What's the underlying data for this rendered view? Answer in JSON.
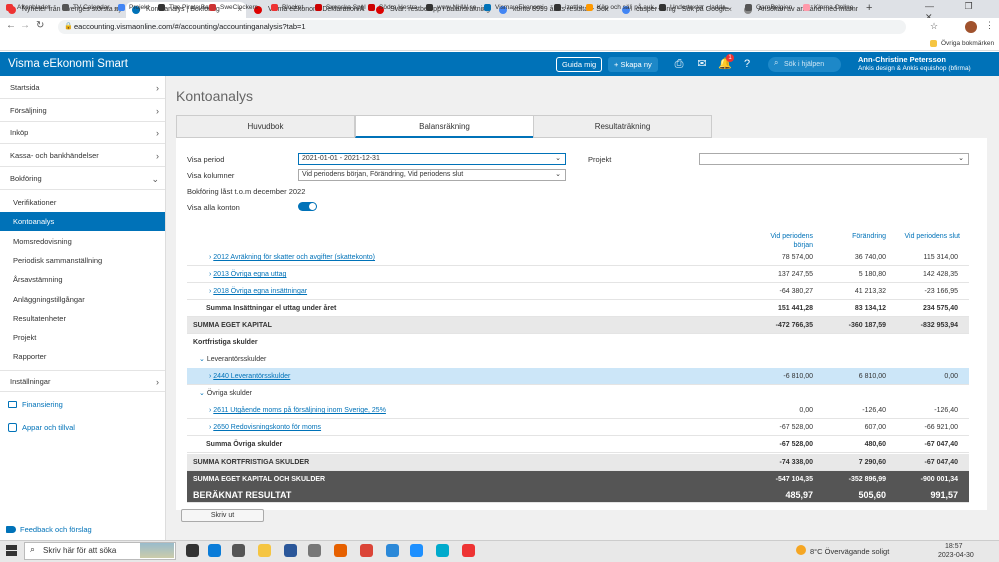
{
  "browser": {
    "tabs": [
      {
        "title": "Nyheter från Sveriges största ny",
        "color": "#e33"
      },
      {
        "title": "Kontoanalys | Bokföring",
        "color": "#0072b8"
      },
      {
        "title": "Visma eEkonomi Deklaration/Å",
        "color": "#d00"
      },
      {
        "title": "Svar: restbelopp i balansräkning",
        "color": "#d00"
      },
      {
        "title": "konto 8999 årets resultat - Sök",
        "color": "#4285f4"
      },
      {
        "title": "casper konig - Sök på Google",
        "color": "#4285f4"
      },
      {
        "title": "Ansökan av anstånd med inlämn",
        "color": "#888"
      }
    ],
    "url": "eaccounting.vismaonline.com/#/accounting/accountinganalysis?tab=1",
    "bookmarks": [
      {
        "label": "Aftonbladet",
        "color": "#e33"
      },
      {
        "label": "TV Calendar",
        "color": "#555"
      },
      {
        "label": "Projekt",
        "color": "#4285f4"
      },
      {
        "label": "The Pirate Bay",
        "color": "#333"
      },
      {
        "label": "SweClockers",
        "color": "#c33"
      },
      {
        "label": "Blocket",
        "color": "#e33"
      },
      {
        "label": "Svenska Spel",
        "color": "#c00"
      },
      {
        "label": "Södra Hestra",
        "color": "#c00"
      },
      {
        "label": "www.NHW.se",
        "color": "#333"
      },
      {
        "label": "Visma eEkonomi",
        "color": "#0072b8"
      },
      {
        "label": "izettle",
        "color": "#333"
      },
      {
        "label": "Köp och sälj på auk...",
        "color": "#f90"
      },
      {
        "label": "Undertexter - ladda...",
        "color": "#333"
      },
      {
        "label": "GarnBelgien",
        "color": "#555"
      },
      {
        "label": "Klarna Online",
        "color": "#f9a"
      }
    ],
    "other_bookmarks": "Övriga bokmärken"
  },
  "header": {
    "brand": "Visma eEkonomi Smart",
    "guide": "Guida mig",
    "create": "+ Skapa ny",
    "search_placeholder": "Sök i hjälpen",
    "notification_count": "1",
    "user_name": "Ann-Christine Petersson",
    "company": "Ankis design & Ankis equishop (bfirma)"
  },
  "sidebar": {
    "items": [
      "Startsida",
      "Försäljning",
      "Inköp",
      "Kassa- och bankhändelser",
      "Bokföring"
    ],
    "sub": [
      "Verifikationer",
      "Kontoanalys",
      "Momsredovisning",
      "Periodisk sammanställning",
      "Årsavstämning",
      "Anläggningstillgångar",
      "Resultatenheter",
      "Projekt",
      "Rapporter"
    ],
    "settings": "Inställningar",
    "financing": "Finansiering",
    "apps": "Appar och tillval",
    "feedback": "Feedback och förslag"
  },
  "page": {
    "title": "Kontoanalys",
    "tabs": [
      "Huvudbok",
      "Balansräkning",
      "Resultaträkning"
    ],
    "period_label": "Visa period",
    "period_value": "2021-01-01 - 2021-12-31",
    "columns_label": "Visa kolumner",
    "columns_value": "Vid periodens början, Förändring, Vid periodens slut",
    "project_label": "Projekt",
    "locked_text": "Bokföring låst t.o.m december 2022",
    "show_all": "Visa alla konton",
    "col_start": "Vid periodens början",
    "col_change": "Förändring",
    "col_end": "Vid periodens slut",
    "print": "Skriv ut"
  },
  "rows": [
    {
      "name": "2012 Avräkning för skatter och avgifter (skattekonto)",
      "start": "78 574,00",
      "change": "36 740,00",
      "end": "115 314,00",
      "type": "link",
      "indent": 1
    },
    {
      "name": "2013 Övriga egna uttag",
      "start": "137 247,55",
      "change": "5 180,80",
      "end": "142 428,35",
      "type": "link",
      "indent": 1
    },
    {
      "name": "2018 Övriga egna insättningar",
      "start": "-64 380,27",
      "change": "41 213,32",
      "end": "-23 166,95",
      "type": "link",
      "indent": 1
    },
    {
      "name": "Summa Insättningar el uttag under året",
      "start": "151 441,28",
      "change": "83 134,12",
      "end": "234 575,40",
      "type": "sum",
      "indent": 0
    },
    {
      "name": "SUMMA EGET KAPITAL",
      "start": "-472 766,35",
      "change": "-360 187,59",
      "end": "-832 953,94",
      "type": "gray",
      "indent": 0
    },
    {
      "name": "Kortfristiga skulder",
      "start": "",
      "change": "",
      "end": "",
      "type": "heading",
      "indent": 0
    },
    {
      "name": "Leverantörsskulder",
      "start": "",
      "change": "",
      "end": "",
      "type": "group",
      "indent": 0
    },
    {
      "name": "2440 Leverantörsskulder",
      "start": "-6 810,00",
      "change": "6 810,00",
      "end": "0,00",
      "type": "link-hl",
      "indent": 1
    },
    {
      "name": "Övriga skulder",
      "start": "",
      "change": "",
      "end": "",
      "type": "group",
      "indent": 0
    },
    {
      "name": "2611 Utgående moms på försäljning inom Sverige, 25%",
      "start": "0,00",
      "change": "-126,40",
      "end": "-126,40",
      "type": "link",
      "indent": 1
    },
    {
      "name": "2650 Redovisningskonto för moms",
      "start": "-67 528,00",
      "change": "607,00",
      "end": "-66 921,00",
      "type": "link",
      "indent": 1
    },
    {
      "name": "Summa Övriga skulder",
      "start": "-67 528,00",
      "change": "480,60",
      "end": "-67 047,40",
      "type": "sum",
      "indent": 0
    },
    {
      "name": "SUMMA KORTFRISTIGA SKULDER",
      "start": "-74 338,00",
      "change": "7 290,60",
      "end": "-67 047,40",
      "type": "gray",
      "indent": 0
    },
    {
      "name": "SUMMA EGET KAPITAL OCH SKULDER",
      "start": "-547 104,35",
      "change": "-352 896,99",
      "end": "-900 001,34",
      "type": "dark",
      "indent": 0
    },
    {
      "name": "BERÄKNAT RESULTAT",
      "start": "485,97",
      "change": "505,60",
      "end": "991,57",
      "type": "dark-big",
      "indent": 0
    }
  ],
  "taskbar": {
    "search": "Skriv här för att söka",
    "weather": "8°C  Övervägande soligt",
    "time": "18:57",
    "date": "2023-04-30"
  }
}
